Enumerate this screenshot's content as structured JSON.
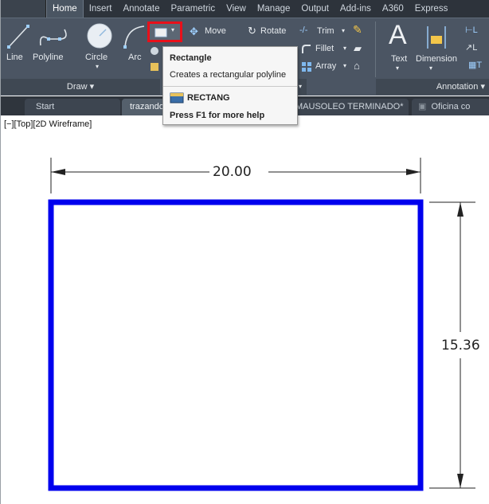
{
  "ribbon": {
    "tabs": [
      "Home",
      "Insert",
      "Annotate",
      "Parametric",
      "View",
      "Manage",
      "Output",
      "Add-ins",
      "A360",
      "Express"
    ],
    "active_tab": "Home",
    "draw_tools": {
      "line": "Line",
      "polyline": "Polyline",
      "circle": "Circle",
      "arc": "Arc"
    },
    "modify_tools": {
      "move": "Move",
      "rotate": "Rotate",
      "trim": "Trim",
      "fillet": "Fillet",
      "array": "Array"
    },
    "annotation_tools": {
      "text": "Text",
      "dimension": "Dimension"
    },
    "panel_titles": {
      "draw": "Draw ▾",
      "annotation": "Annotation ▾"
    }
  },
  "tooltip": {
    "title": "Rectangle",
    "description": "Creates a rectangular polyline",
    "command": "RECTANG",
    "help": "Press F1 for more help"
  },
  "doc_tabs": {
    "start": "Start",
    "tab2": "trazando",
    "tab3": "MAUSOLEO TERMINADO*",
    "tab3_close": "✕",
    "tab4": "Oficina co"
  },
  "viewport": {
    "label": "[−][Top][2D Wireframe]"
  },
  "drawing": {
    "width_dimension": "20.00",
    "height_dimension": "15.36"
  },
  "colors": {
    "rectangle_stroke": "#0000ee",
    "highlight": "#e8101a",
    "ribbon_bg": "#4b5563"
  }
}
